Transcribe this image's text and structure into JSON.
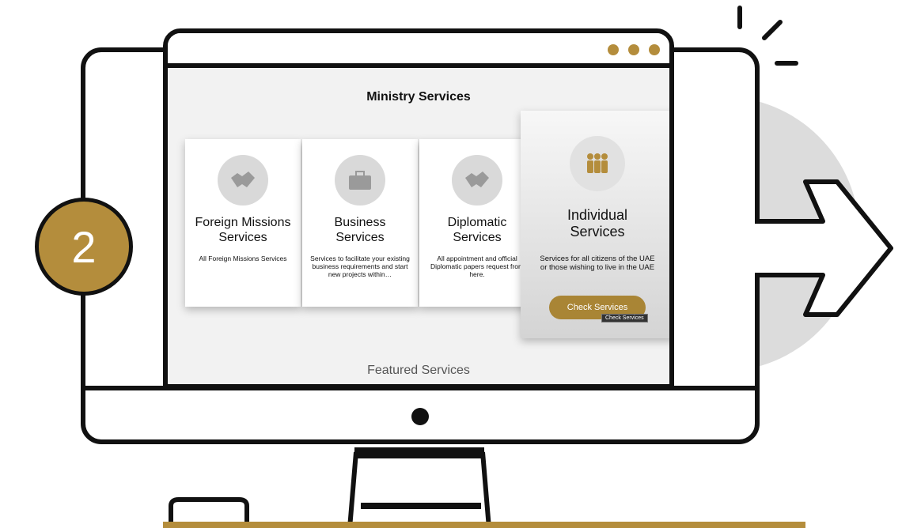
{
  "step": {
    "number": "2"
  },
  "browser": {
    "window_dots_color": "#b48d3c"
  },
  "page": {
    "title": "Ministry Services",
    "featured_heading": "Featured Services"
  },
  "cards": [
    {
      "icon": "handshake-icon",
      "title_line1": "Foreign Missions",
      "title_line2": "Services",
      "description": "All Foreign Missions Services"
    },
    {
      "icon": "briefcase-icon",
      "title_line1": "Business",
      "title_line2": "Services",
      "description": "Services to facilitate your existing business requirements and start new projects within…"
    },
    {
      "icon": "handshake-icon",
      "title_line1": "Diplomatic",
      "title_line2": "Services",
      "description": "All appointment and official Diplomatic papers request from here."
    },
    {
      "icon": "people-icon",
      "title_line1": "Individual",
      "title_line2": "Services",
      "description": "Services for all citizens of the UAE or those wishing to live in the UAE",
      "button_label": "Check Services",
      "tooltip": "Check Services"
    }
  ],
  "colors": {
    "accent": "#b48d3c",
    "button": "#a98535"
  }
}
